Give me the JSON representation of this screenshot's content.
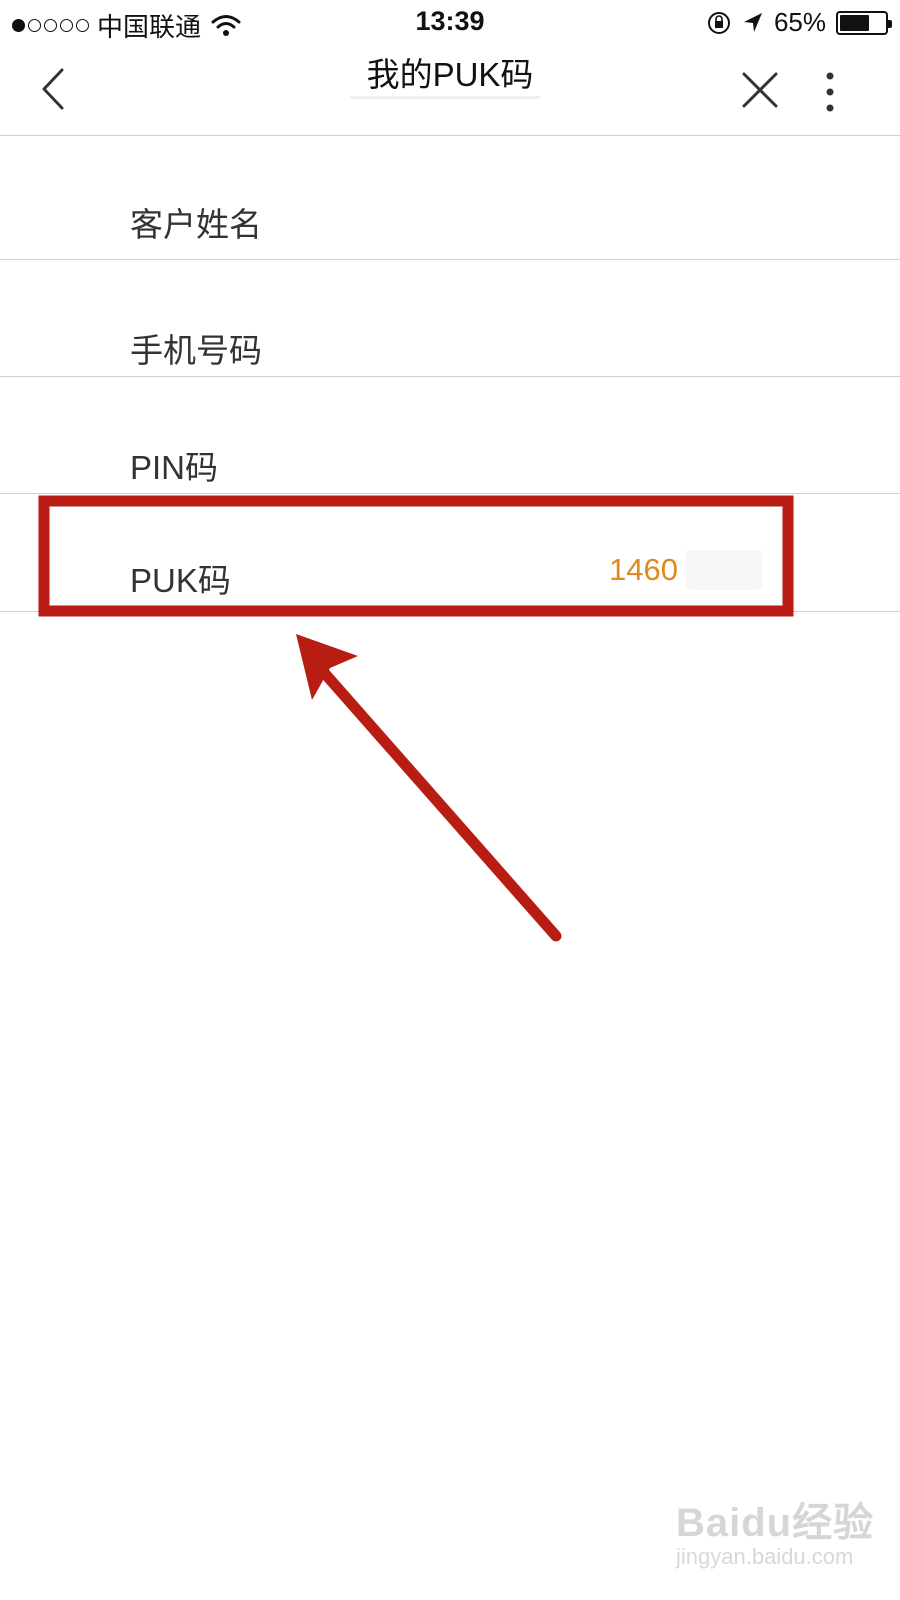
{
  "status_bar": {
    "carrier": "中国联通",
    "time": "13:39",
    "battery": "65%",
    "battery_level": 0.65,
    "signal_strength": 1,
    "signal_total": 5
  },
  "nav": {
    "title": "我的PUK码",
    "icons": {
      "back": "chevron-left-icon",
      "close": "close-icon",
      "more": "more-vertical-icon"
    }
  },
  "list": {
    "items": [
      {
        "label": "客户姓名",
        "value": ""
      },
      {
        "label": "手机号码",
        "value": ""
      },
      {
        "label": "PIN码",
        "value": ""
      },
      {
        "label": "PUK码",
        "value": "1460"
      }
    ]
  },
  "colors": {
    "accent_value": "#e0891c",
    "annotation_red": "#b81d14",
    "divider": "#cfcfcf"
  },
  "watermark": {
    "brand": "Baidu经验",
    "site": "jingyan.baidu.com"
  }
}
